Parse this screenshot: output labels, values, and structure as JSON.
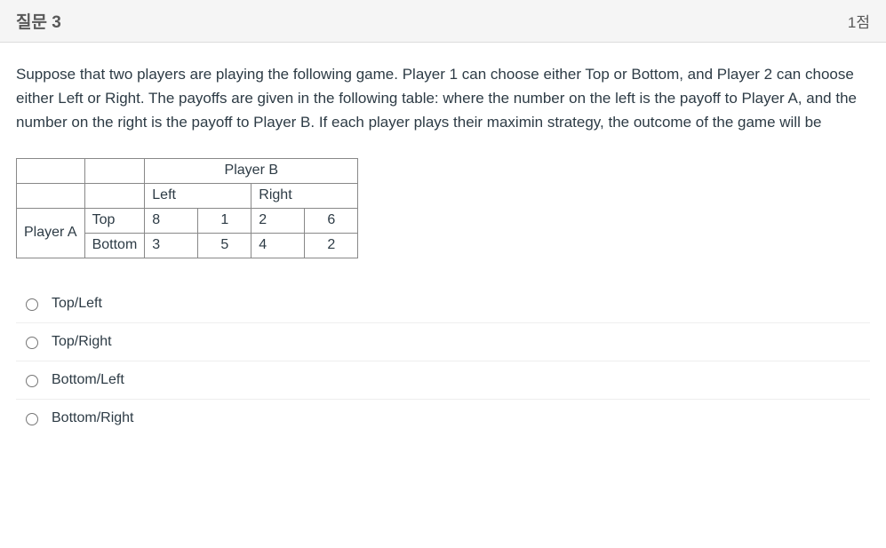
{
  "header": {
    "title": "질문 3",
    "points": "1점"
  },
  "prompt": "Suppose that two players are playing the following game. Player 1 can choose either Top or Bottom, and Player 2 can choose either Left or Right. The payoffs are given in the following table: where the number on the left is the payoff to Player A, and the number on the right is the payoff to Player B. If each player plays their maximin strategy, the outcome of the game will be",
  "table": {
    "col_player": "Player B",
    "row_player": "Player A",
    "col_labels": [
      "Left",
      "Right"
    ],
    "row_labels": [
      "Top",
      "Bottom"
    ],
    "cells": [
      [
        {
          "a": "8",
          "b": "1"
        },
        {
          "a": "2",
          "b": "6"
        }
      ],
      [
        {
          "a": "3",
          "b": "5"
        },
        {
          "a": "4",
          "b": "2"
        }
      ]
    ]
  },
  "answers": [
    "Top/Left",
    "Top/Right",
    "Bottom/Left",
    "Bottom/Right"
  ]
}
